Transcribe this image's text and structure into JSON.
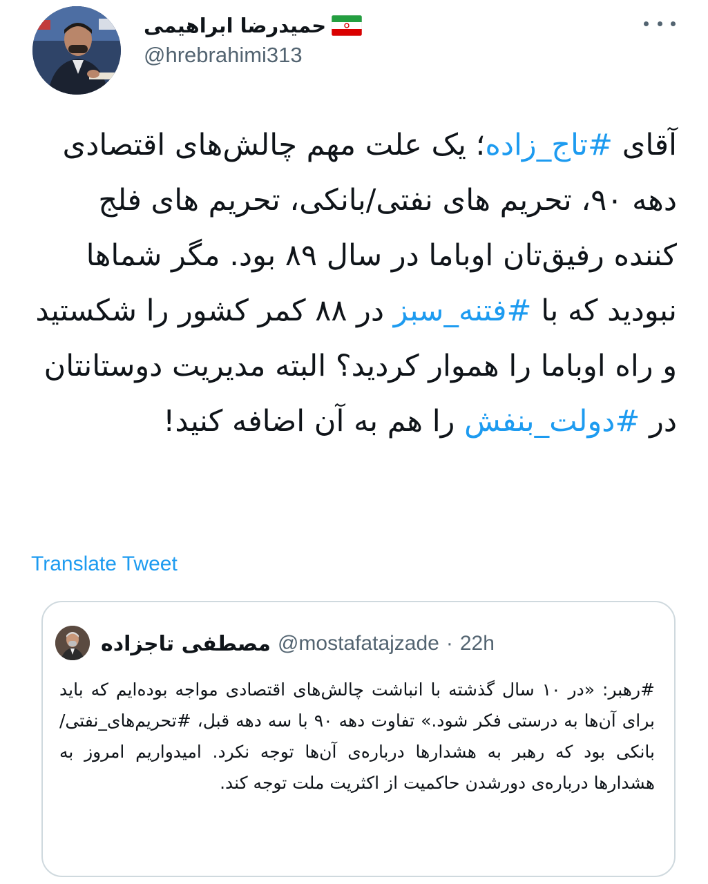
{
  "tweet": {
    "display_name": "حمیدرضا ابراهیمی",
    "handle": "@hrebrahimi313",
    "flag_icon": "iran-flag-icon",
    "more_icon": "more-options-icon",
    "body": {
      "prefix": "آقای ",
      "hashtag1": "#تاج_زاده",
      "part2": "؛ یک علت مهم چالش‌های اقتصادی دهه ۹۰، تحریم های نفتی/بانکی، تحریم های فلج کننده رفیق‌تان اوباما در سال ۸۹ بود. مگر شماها نبودید که با ",
      "hashtag2": "#فتنه_سبز",
      "part3": " در ۸۸ کمر کشور را شکستید و راه اوباما را هموار کردید؟ البته مدیریت دوستانتان در ",
      "hashtag3": "#دولت_بنفش",
      "part4": " را هم به آن اضافه کنید!"
    },
    "translate_label": "Translate Tweet",
    "colors": {
      "link": "#1d9bf0",
      "text": "#0f1419",
      "muted": "#536471",
      "border": "#cfd9de"
    }
  },
  "quoted_tweet": {
    "display_name": "مصطفی تاجزاده",
    "handle": "@mostafatajzade",
    "separator": "·",
    "time": "22h",
    "text": "#رهبر: «در ۱۰ سال گذشته با انباشت چالش‌های اقتصادی مواجه بوده‌ایم که باید برای آن‌ها به درستی فکر شود.» تفاوت دهه ۹۰ با سه دهه قبل، #تحریم‌های_نفتی/بانکی بود که رهبر به هشدارها درباره‌ی آن‌ها توجه نکرد. امیدواریم امروز به هشدارها درباره‌ی دورشدن حاکمیت از اکثریت ملت توجه کند."
  }
}
